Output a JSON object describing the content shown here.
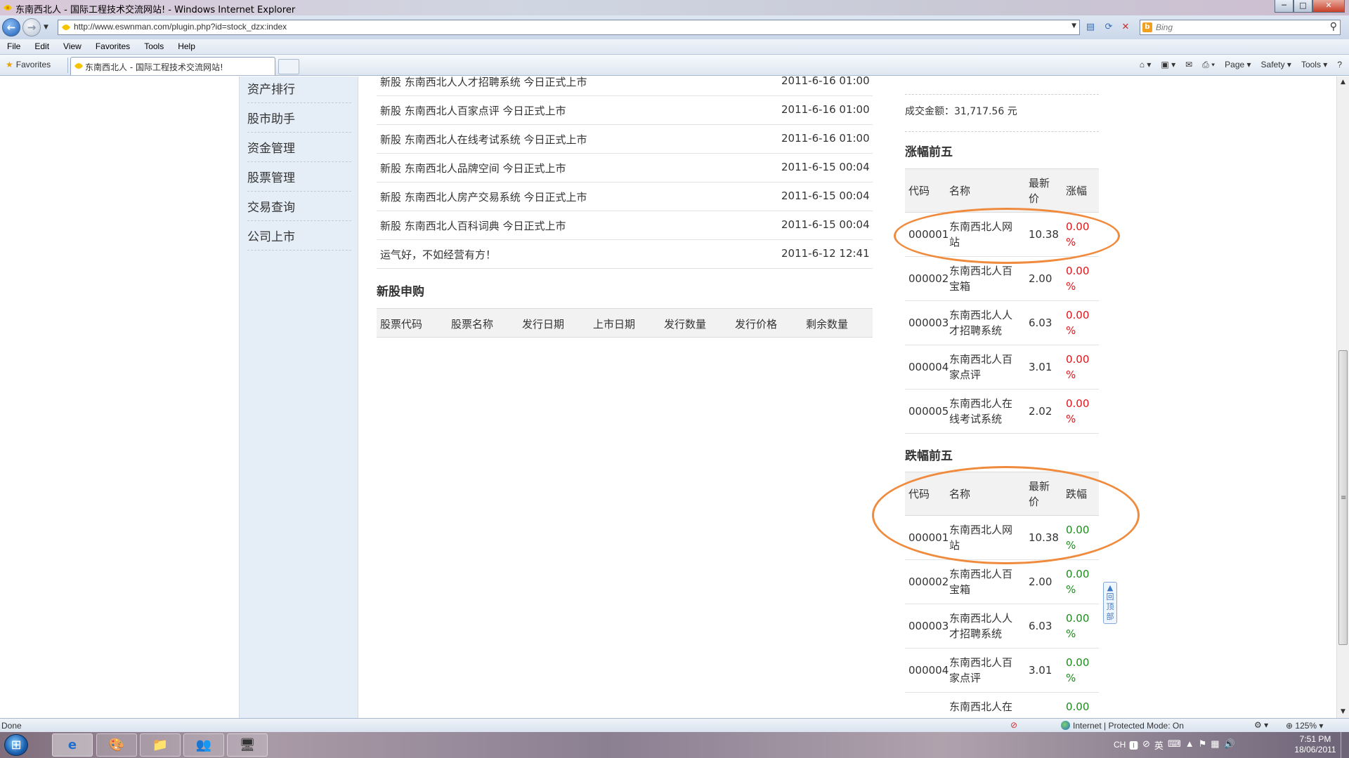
{
  "window": {
    "title": "东南西北人 - 国际工程技术交流网站! - Windows Internet Explorer",
    "minimize": "─",
    "maximize": "□",
    "close": "✕"
  },
  "address": {
    "url": "http://www.eswnman.com/plugin.php?id=stock_dzx:index",
    "search_placeholder": "Bing"
  },
  "menu": [
    "File",
    "Edit",
    "View",
    "Favorites",
    "Tools",
    "Help"
  ],
  "favbar": {
    "favorites_label": "Favorites",
    "tab_title": "东南西北人 - 国际工程技术交流网站!",
    "commands": [
      "Page ▾",
      "Safety ▾",
      "Tools ▾",
      "?"
    ]
  },
  "leftnav": [
    "资产排行",
    "股市助手",
    "资金管理",
    "股票管理",
    "交易查询",
    "公司上市"
  ],
  "news": [
    {
      "title": "新股 东南西北人人才招聘系统 今日正式上市",
      "date": "2011-6-16 01:00"
    },
    {
      "title": "新股 东南西北人百家点评 今日正式上市",
      "date": "2011-6-16 01:00"
    },
    {
      "title": "新股 东南西北人在线考试系统 今日正式上市",
      "date": "2011-6-16 01:00"
    },
    {
      "title": "新股 东南西北人品牌空间 今日正式上市",
      "date": "2011-6-15 00:04"
    },
    {
      "title": "新股 东南西北人房产交易系统 今日正式上市",
      "date": "2011-6-15 00:04"
    },
    {
      "title": "新股 东南西北人百科词典 今日正式上市",
      "date": "2011-6-15 00:04"
    },
    {
      "title": "运气好，不如经营有方！",
      "date": "2011-6-12 12:41"
    }
  ],
  "ipo": {
    "title": "新股申购",
    "columns": [
      "股票代码",
      "股票名称",
      "发行日期",
      "上市日期",
      "发行数量",
      "发行价格",
      "剩余数量"
    ]
  },
  "market": {
    "turnover": "成交金额：31,717.56 元"
  },
  "gainers": {
    "title": "涨幅前五",
    "headers": {
      "code": "代码",
      "name": "名称",
      "price": "最新价",
      "change": "涨幅"
    },
    "rows": [
      {
        "code": "000001",
        "name": "东南西北人网站",
        "price": "10.38",
        "change": "0.00 %"
      },
      {
        "code": "000002",
        "name": "东南西北人百宝箱",
        "price": "2.00",
        "change": "0.00 %"
      },
      {
        "code": "000003",
        "name": "东南西北人人才招聘系统",
        "price": "6.03",
        "change": "0.00 %"
      },
      {
        "code": "000004",
        "name": "东南西北人百家点评",
        "price": "3.01",
        "change": "0.00 %"
      },
      {
        "code": "000005",
        "name": "东南西北人在线考试系统",
        "price": "2.02",
        "change": "0.00 %"
      }
    ]
  },
  "losers": {
    "title": "跌幅前五",
    "headers": {
      "code": "代码",
      "name": "名称",
      "price": "最新价",
      "change": "跌幅"
    },
    "rows": [
      {
        "code": "000001",
        "name": "东南西北人网站",
        "price": "10.38",
        "change": "0.00 %"
      },
      {
        "code": "000002",
        "name": "东南西北人百宝箱",
        "price": "2.00",
        "change": "0.00 %"
      },
      {
        "code": "000003",
        "name": "东南西北人人才招聘系统",
        "price": "6.03",
        "change": "0.00 %"
      },
      {
        "code": "000004",
        "name": "东南西北人百家点评",
        "price": "3.01",
        "change": "0.00 %"
      },
      {
        "code": "",
        "name": "东南西北人在",
        "price": "",
        "change": "0.00"
      }
    ]
  },
  "back_to_top": "回顶部",
  "status": {
    "left": "Done",
    "zone": "Internet | Protected Mode: On",
    "zoom": "125% ▾"
  },
  "taskbar": {
    "lang": "CH",
    "time": "7:51 PM",
    "date": "18/06/2011"
  },
  "colors": {
    "gain": "#e0151a",
    "loss": "#1e8a1e",
    "annotation": "#f08a3c",
    "sidebar": "#e5eef7"
  }
}
